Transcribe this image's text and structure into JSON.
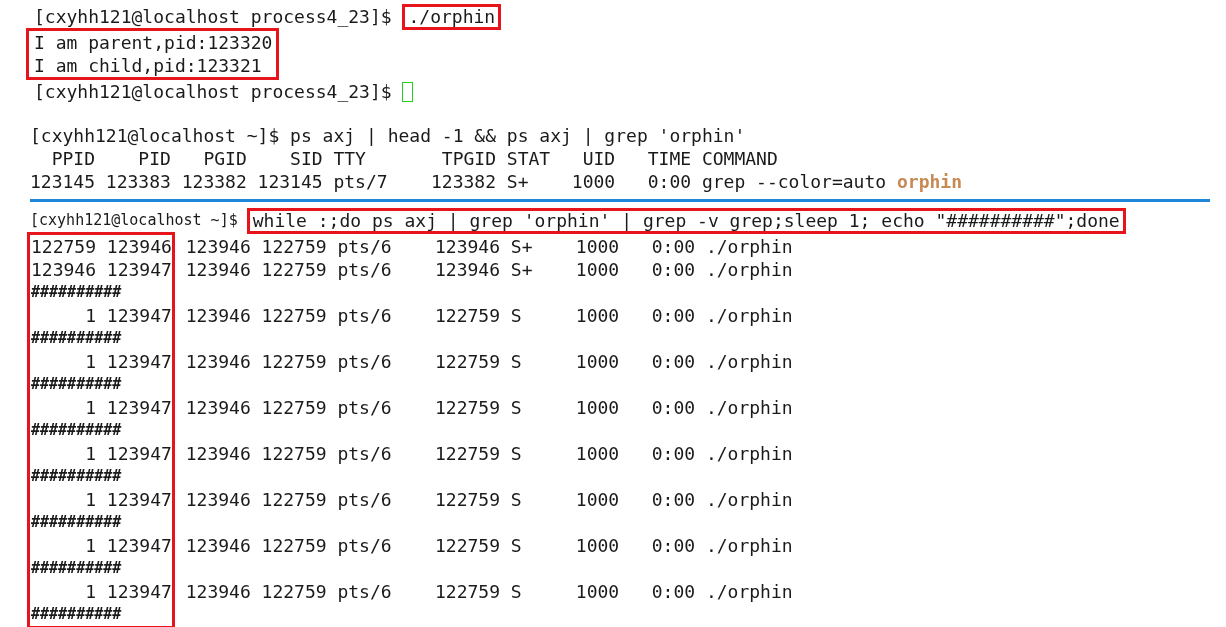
{
  "panel_1": {
    "prompt": "[cxyhh121@localhost process4_23]$ ",
    "command": "./orphin",
    "command_highlighted": true,
    "output": [
      "I am parent,pid:123320",
      "I am child,pid:123321"
    ],
    "output_highlighted": true,
    "prompt_2": "[cxyhh121@localhost process4_23]$ "
  },
  "panel_2": {
    "prompt": "[cxyhh121@localhost ~]$ ",
    "command": "ps axj | head -1 && ps axj | grep 'orphin'",
    "header": "  PPID    PID   PGID    SID TTY       TPGID STAT   UID   TIME COMMAND",
    "row": "123145 123383 123382 123145 pts/7    123382 S+    1000   0:00 grep --color=auto ",
    "match": "orphin"
  },
  "panel_3": {
    "prompt": "[cxyhh121@localhost ~]$ ",
    "command": "while :;do ps axj | grep 'orphin' | grep -v grep;sleep 1; echo \"##########\";done",
    "command_highlighted": true,
    "ids_highlighted": true,
    "lines": [
      {
        "kind": "row",
        "ids": "122759 123946",
        "rest": " 123946 122759 pts/6    123946 S+    1000   0:00 ./orphin"
      },
      {
        "kind": "row",
        "ids": "123946 123947",
        "rest": " 123946 122759 pts/6    123946 S+    1000   0:00 ./orphin"
      },
      {
        "kind": "separator",
        "text": "##########"
      },
      {
        "kind": "row",
        "ids": "     1 123947",
        "rest": " 123946 122759 pts/6    122759 S     1000   0:00 ./orphin"
      },
      {
        "kind": "separator",
        "text": "##########"
      },
      {
        "kind": "row",
        "ids": "     1 123947",
        "rest": " 123946 122759 pts/6    122759 S     1000   0:00 ./orphin"
      },
      {
        "kind": "separator",
        "text": "##########"
      },
      {
        "kind": "row",
        "ids": "     1 123947",
        "rest": " 123946 122759 pts/6    122759 S     1000   0:00 ./orphin"
      },
      {
        "kind": "separator",
        "text": "##########"
      },
      {
        "kind": "row",
        "ids": "     1 123947",
        "rest": " 123946 122759 pts/6    122759 S     1000   0:00 ./orphin"
      },
      {
        "kind": "separator",
        "text": "##########"
      },
      {
        "kind": "row",
        "ids": "     1 123947",
        "rest": " 123946 122759 pts/6    122759 S     1000   0:00 ./orphin"
      },
      {
        "kind": "separator",
        "text": "##########"
      },
      {
        "kind": "row",
        "ids": "     1 123947",
        "rest": " 123946 122759 pts/6    122759 S     1000   0:00 ./orphin"
      },
      {
        "kind": "separator",
        "text": "##########"
      },
      {
        "kind": "row",
        "ids": "     1 123947",
        "rest": " 123946 122759 pts/6    122759 S     1000   0:00 ./orphin"
      },
      {
        "kind": "separator",
        "text": "##########"
      }
    ]
  }
}
